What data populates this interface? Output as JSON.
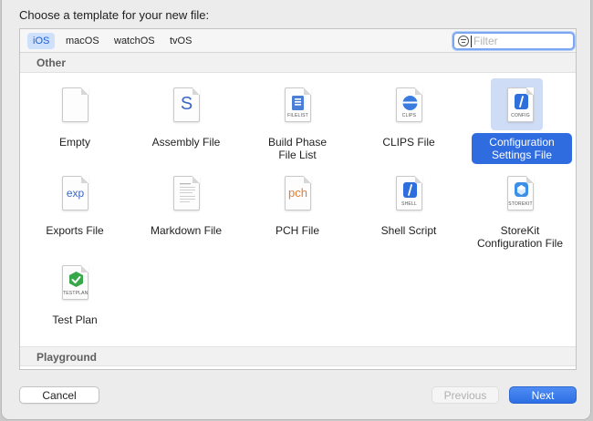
{
  "dialog": {
    "prompt": "Choose a template for your new file:"
  },
  "tabs": [
    {
      "label": "iOS",
      "active": true
    },
    {
      "label": "macOS",
      "active": false
    },
    {
      "label": "watchOS",
      "active": false
    },
    {
      "label": "tvOS",
      "active": false
    }
  ],
  "filter": {
    "placeholder": "Filter",
    "value": ""
  },
  "sections": {
    "other": "Other",
    "playground": "Playground"
  },
  "templates": [
    {
      "label": "Empty",
      "icon": "empty-file-icon",
      "selected": false
    },
    {
      "label": "Assembly File",
      "icon": "assembly-file-icon",
      "glyph": "S",
      "selected": false
    },
    {
      "label_lines": [
        "Build Phase",
        "File List"
      ],
      "icon": "filelist-icon",
      "caption": "FILELIST",
      "selected": false
    },
    {
      "label": "CLIPS File",
      "icon": "clips-icon",
      "caption": "CLIPS",
      "selected": false
    },
    {
      "label_lines": [
        "Configuration",
        "Settings File"
      ],
      "icon": "config-icon",
      "caption": "CONFIG",
      "selected": true
    },
    {
      "label": "Exports File",
      "icon": "exports-icon",
      "glyph": "exp",
      "selected": false
    },
    {
      "label": "Markdown File",
      "icon": "markdown-icon",
      "selected": false
    },
    {
      "label": "PCH File",
      "icon": "pch-icon",
      "glyph": "pch",
      "selected": false
    },
    {
      "label": "Shell Script",
      "icon": "shell-icon",
      "caption": "SHELL",
      "selected": false
    },
    {
      "label_lines": [
        "StoreKit",
        "Configuration File"
      ],
      "icon": "storekit-icon",
      "caption": "STOREKIT",
      "selected": false
    },
    {
      "label": "Test Plan",
      "icon": "testplan-icon",
      "caption": "TESTPLAN",
      "selected": false
    }
  ],
  "buttons": {
    "cancel": "Cancel",
    "previous": "Previous",
    "next": "Next"
  },
  "colors": {
    "accent": "#2e6ce0",
    "selection_bg": "#cfdcf6"
  }
}
